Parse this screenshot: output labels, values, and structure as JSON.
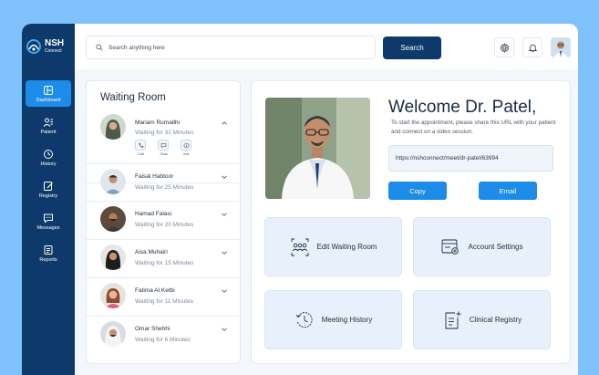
{
  "app": {
    "logo_line1": "NSH",
    "logo_line2": "Connect"
  },
  "sidebar": {
    "items": [
      {
        "label": "Dashboard",
        "icon": "dashboard-icon",
        "active": true
      },
      {
        "label": "Patient",
        "icon": "patient-icon"
      },
      {
        "label": "History",
        "icon": "history-icon"
      },
      {
        "label": "Registry",
        "icon": "registry-icon"
      },
      {
        "label": "Messages",
        "icon": "messages-icon"
      },
      {
        "label": "Reports",
        "icon": "reports-icon"
      }
    ]
  },
  "topbar": {
    "search_placeholder": "Search anything here",
    "search_button": "Search",
    "icons": [
      "gear-icon",
      "bell-icon",
      "user-avatar"
    ]
  },
  "waiting_room": {
    "title": "Waiting Room",
    "patients": [
      {
        "name": "Mariam Rumaithi",
        "wait": "Waiting for 32 Minutes",
        "expanded": true
      },
      {
        "name": "Faisal Habtoor",
        "wait": "Waiting for 25 Minutes"
      },
      {
        "name": "Hamad Falasi",
        "wait": "Waiting for 20 Minutes"
      },
      {
        "name": "Aisa Muhairi",
        "wait": "Waiting for 15 Minutes"
      },
      {
        "name": "Fatima Al Ketbi",
        "wait": "Waiting for 11 Minutes"
      },
      {
        "name": "Omar Shehhi",
        "wait": "Waiting for 6 Minutes"
      }
    ],
    "actions": [
      "Call",
      "Chat",
      "Info"
    ]
  },
  "welcome": {
    "title": "Welcome Dr. Patel,",
    "description": "To start the appointment, please share this URL with your patient and connect on a video session.",
    "url": "https://nshconnect/meet/dr-patel/63994",
    "copy_button": "Copy",
    "email_button": "Email"
  },
  "cards": [
    {
      "label": "Edit Waiting Room",
      "icon": "waiting-room-icon"
    },
    {
      "label": "Account Settings",
      "icon": "account-settings-icon"
    },
    {
      "label": "Meeting History",
      "icon": "meeting-history-icon"
    },
    {
      "label": "Clinical Registry",
      "icon": "clinical-registry-icon"
    }
  ],
  "colors": {
    "navy": "#0d3a6a",
    "accent": "#1c8ce8",
    "background": "#7ec1fb",
    "card": "#e8f1fb"
  }
}
